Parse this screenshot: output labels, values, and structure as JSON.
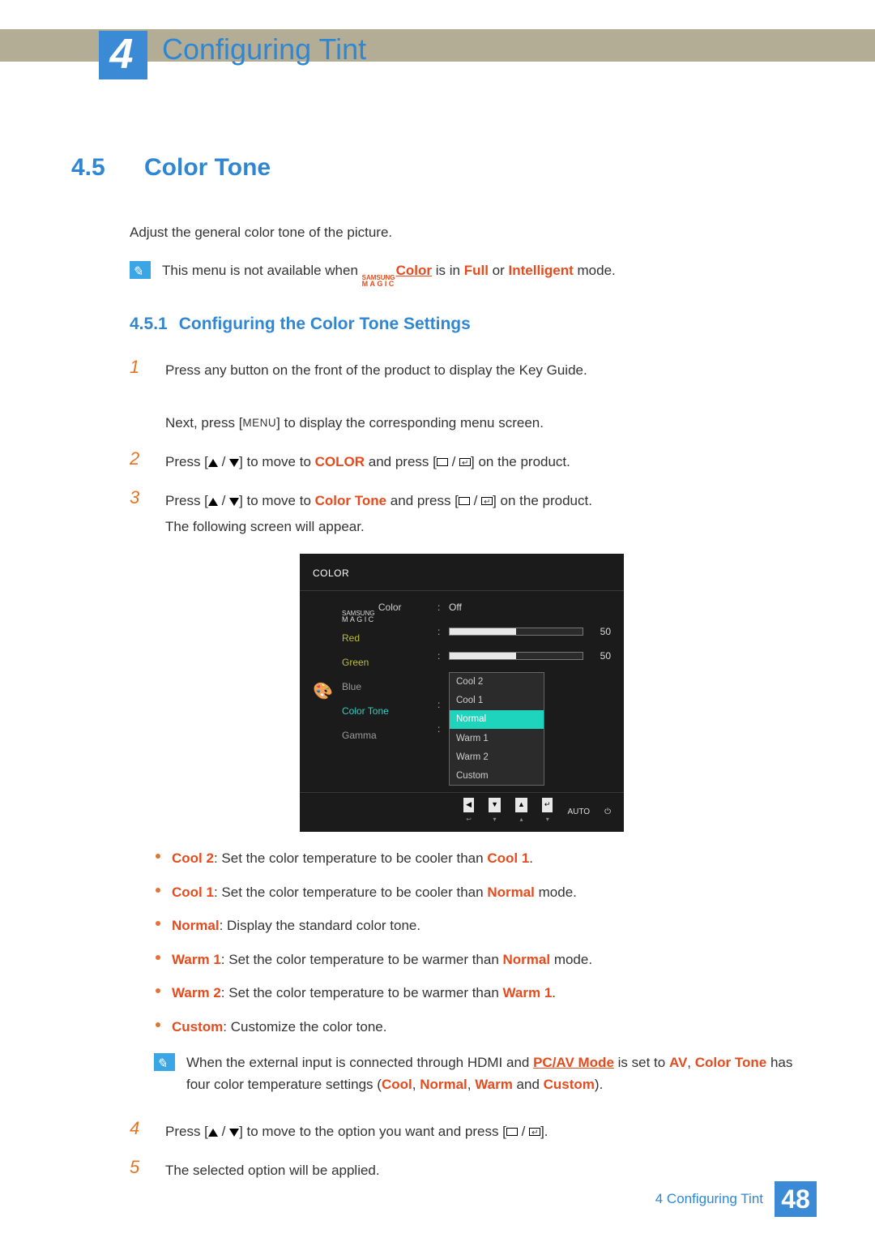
{
  "chapter": {
    "number": "4",
    "title": "Configuring Tint"
  },
  "section": {
    "number": "4.5",
    "title": "Color Tone"
  },
  "intro": "Adjust the general color tone of the picture.",
  "note1": {
    "pre": "This menu is not available when ",
    "brand_top": "SAMSUNG",
    "brand_bottom": "MAGIC",
    "brand_word": "Color",
    "mid": " is in ",
    "full": "Full",
    "or": " or ",
    "intel": "Intelligent",
    "post": " mode."
  },
  "subsection": {
    "number": "4.5.1",
    "title": "Configuring the Color Tone Settings"
  },
  "steps": {
    "s1a": "Press any button on the front of the product to display the Key Guide.",
    "s1b_pre": "Next, press [",
    "s1b_menu": "MENU",
    "s1b_post": "] to display the corresponding menu screen.",
    "s2_pre": "Press [",
    "s2_mid": "] to move to ",
    "s2_target": "COLOR",
    "s2_post": " and press [",
    "s2_end": "] on the product.",
    "s3_pre": "Press [",
    "s3_mid": "] to move to ",
    "s3_target": "Color Tone",
    "s3_post": " and press [",
    "s3_end": "] on the product.",
    "s3_follow": "The following screen will appear.",
    "s4_pre": "Press [",
    "s4_mid": "] to move to the option you want and press [",
    "s4_end": "].",
    "s5": "The selected option will be applied."
  },
  "osd": {
    "title": "COLOR",
    "labels": {
      "magic_color_top": "SAMSUNG",
      "magic_color_bottom": "MAGIC",
      "magic_color_word": "Color",
      "red": "Red",
      "green": "Green",
      "blue": "Blue",
      "color_tone": "Color Tone",
      "gamma": "Gamma"
    },
    "magic_color_val": "Off",
    "red_val": "50",
    "green_val": "50",
    "options": [
      "Cool 2",
      "Cool 1",
      "Normal",
      "Warm 1",
      "Warm 2",
      "Custom"
    ],
    "selected": "Normal",
    "nav_auto": "AUTO"
  },
  "bullets": {
    "cool2": {
      "label": "Cool 2",
      "text": ": Set the color temperature to be cooler than ",
      "ref": "Cool 1",
      "post": "."
    },
    "cool1": {
      "label": "Cool 1",
      "text": ": Set the color temperature to be cooler than ",
      "ref": "Normal",
      "post": " mode."
    },
    "normal": {
      "label": "Normal",
      "text": ": Display the standard color tone."
    },
    "warm1": {
      "label": "Warm 1",
      "text": ": Set the color temperature to be warmer than ",
      "ref": "Normal",
      "post": " mode."
    },
    "warm2": {
      "label": "Warm 2",
      "text": ": Set the color temperature to be warmer than ",
      "ref": "Warm 1",
      "post": "."
    },
    "custom": {
      "label": "Custom",
      "text": ": Customize the color tone."
    }
  },
  "note2": {
    "l1_pre": "When the external input is connected through HDMI and ",
    "pcav": "PC/AV Mode",
    "l1_mid": " is set to ",
    "av": "AV",
    "l1_comma": ", ",
    "ct": "Color Tone",
    "l2_pre": "has four color temperature settings (",
    "cool": "Cool",
    "c": ", ",
    "normal": "Normal",
    "warm": "Warm",
    "and": " and ",
    "custom": "Custom",
    "l2_post": ")."
  },
  "footer": {
    "text": "4 Configuring Tint",
    "page": "48"
  }
}
